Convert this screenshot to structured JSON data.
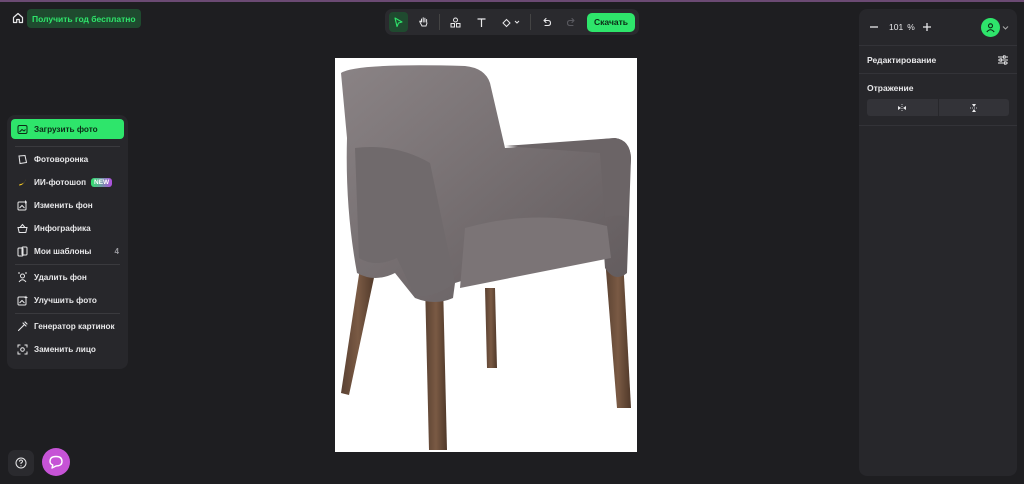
{
  "header": {
    "promo_label": "Получить год бесплатно"
  },
  "toolbar": {
    "download_label": "Скачать"
  },
  "sidebar": {
    "items": [
      {
        "label": "Загрузить фото",
        "icon": "upload-photo-icon"
      },
      {
        "label": "Фотоворонка",
        "icon": "photo-funnel-icon"
      },
      {
        "label": "ИИ-фотошоп",
        "icon": "banana-icon",
        "badge": "NEW"
      },
      {
        "label": "Изменить фон",
        "icon": "change-background-icon"
      },
      {
        "label": "Инфографика",
        "icon": "basket-icon"
      },
      {
        "label": "Мои шаблоны",
        "icon": "templates-icon",
        "count": "4"
      },
      {
        "label": "Удалить фон",
        "icon": "remove-background-icon"
      },
      {
        "label": "Улучшить фото",
        "icon": "enhance-photo-icon"
      },
      {
        "label": "Генератор картинок",
        "icon": "image-generator-icon"
      },
      {
        "label": "Заменить лицо",
        "icon": "face-swap-icon"
      }
    ]
  },
  "zoom": {
    "value": "101",
    "unit": "%"
  },
  "panel": {
    "editing_label": "Редактирование",
    "reflection_label": "Отражение"
  },
  "colors": {
    "accent": "#2ee56b",
    "background": "#1e1e21",
    "panel": "#27272b",
    "chat": "#c653d6"
  }
}
